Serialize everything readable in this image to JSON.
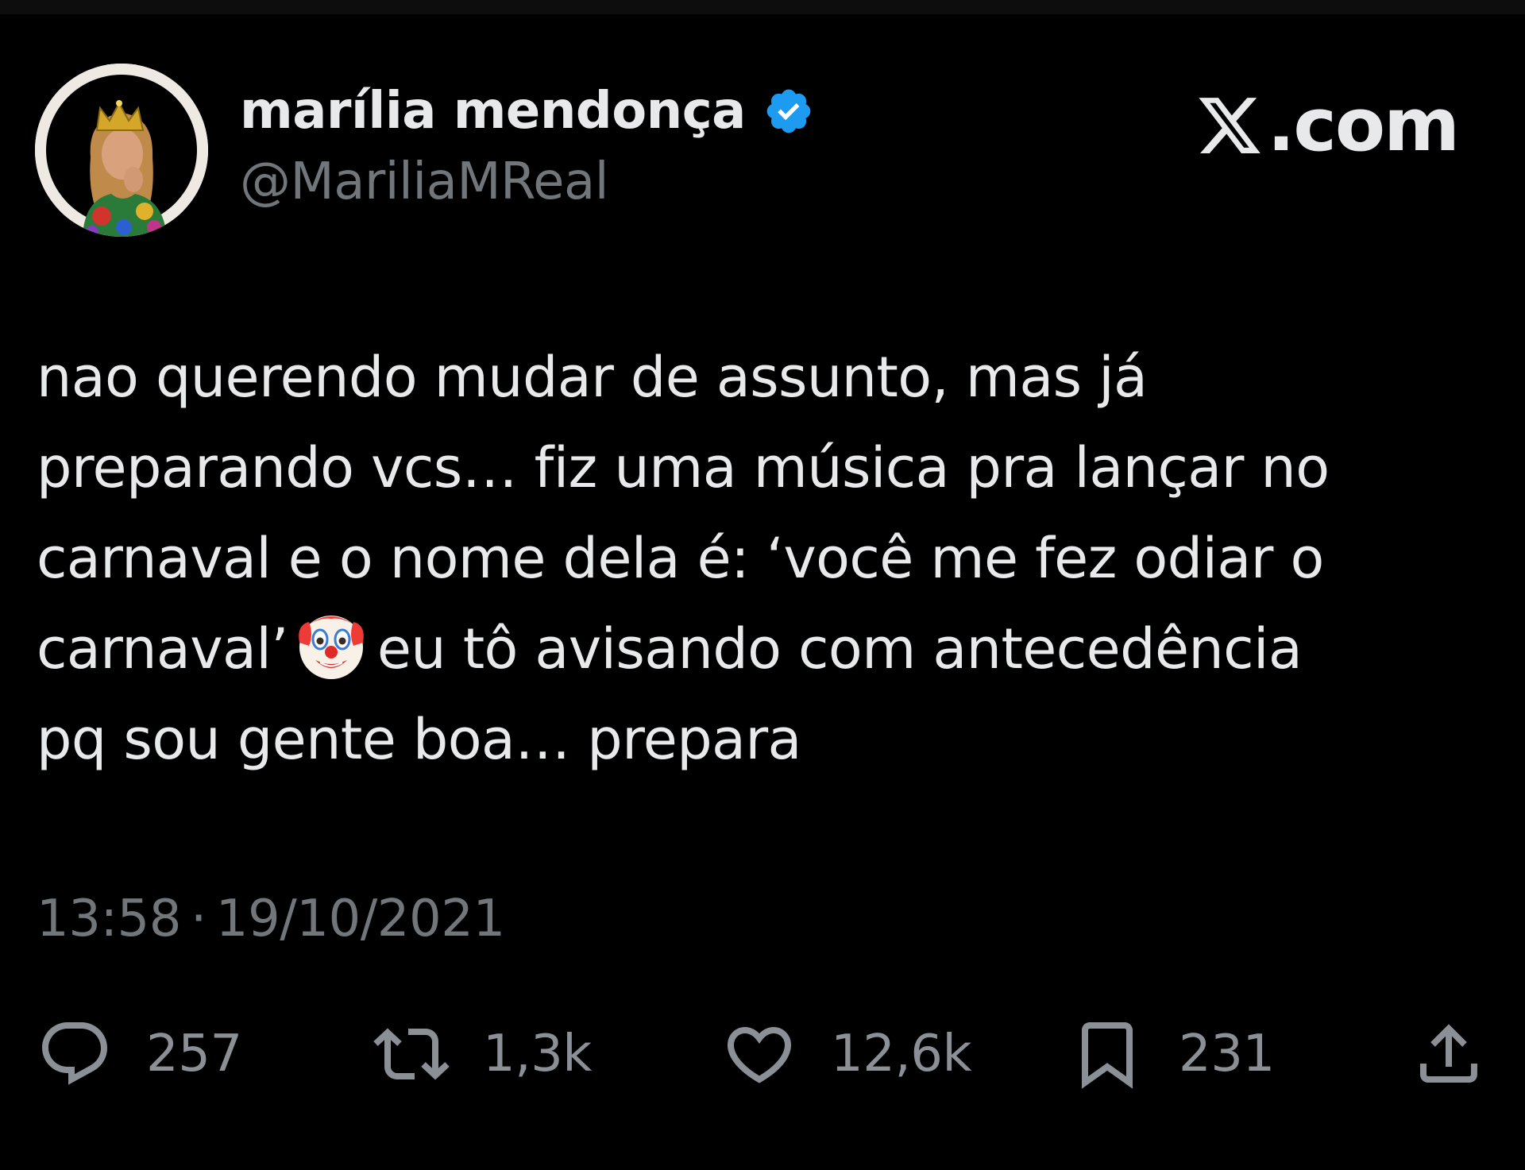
{
  "header": {
    "display_name": "marília mendonça",
    "handle": "@MariliaMReal",
    "verified": true,
    "verified_icon": "verified-badge-icon",
    "brand": {
      "logo_icon": "x-logo-icon",
      "text": ".com"
    }
  },
  "tweet": {
    "lines": [
      "nao querendo mudar de assunto, mas já",
      "preparando vcs… fiz uma música pra lançar no",
      "carnaval e o nome dela é: ‘você me fez odiar o",
      "carnaval’",
      "eu tô avisando com antecedência",
      "pq sou gente boa… prepara"
    ],
    "emoji": "clown-face-icon",
    "time": "13:58",
    "separator": "·",
    "date": "19/10/2021"
  },
  "actions": {
    "replies": {
      "icon": "reply-icon",
      "count": "257"
    },
    "reposts": {
      "icon": "repost-icon",
      "count": "1,3k"
    },
    "likes": {
      "icon": "heart-icon",
      "count": "12,6k"
    },
    "bookmarks": {
      "icon": "bookmark-icon",
      "count": "231"
    },
    "share": {
      "icon": "share-icon"
    }
  },
  "colors": {
    "background": "#000000",
    "text": "#e7e9ea",
    "secondary_text": "#71767b",
    "verified_blue": "#1d9bf0"
  }
}
